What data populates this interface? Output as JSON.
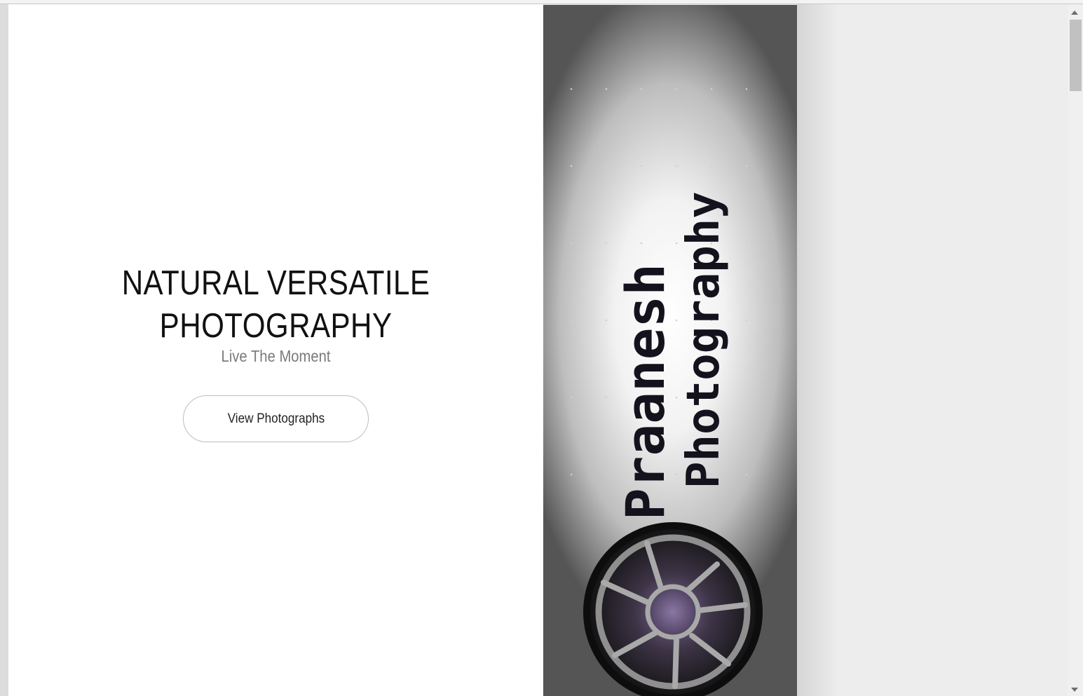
{
  "hero": {
    "title_line1": "NATURAL VERSATILE",
    "title_line2": "PHOTOGRAPHY",
    "subtitle": "Live The Moment",
    "button_label": "View Photographs"
  },
  "banner": {
    "logo_line1": "Praanesh",
    "logo_line2": "Photography",
    "accent_color": "#6a5a80",
    "icon": "camera-aperture-icon"
  },
  "colors": {
    "page_background": "#ededed",
    "hero_background": "#ffffff",
    "title_color": "#111111",
    "subtitle_color": "#7a7a7a"
  }
}
